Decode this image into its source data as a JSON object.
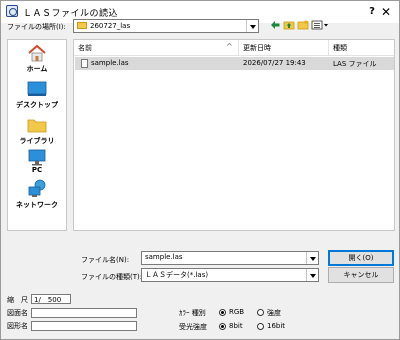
{
  "window": {
    "title": "ＬＡＳファイルの読込",
    "help_label": "?",
    "close_label": "✕"
  },
  "location": {
    "label": "ファイルの場所(I):",
    "value": "260727_las"
  },
  "places": [
    {
      "label": "ホーム",
      "icon": "home-icon"
    },
    {
      "label": "デスクトップ",
      "icon": "desktop-icon"
    },
    {
      "label": "ライブラリ",
      "icon": "library-icon"
    },
    {
      "label": "PC",
      "icon": "pc-icon"
    },
    {
      "label": "ネットワーク",
      "icon": "network-icon"
    }
  ],
  "file_list": {
    "columns": [
      "名前",
      "更新日時",
      "種類"
    ],
    "rows": [
      {
        "name": "sample.las",
        "modified": "2026/07/27 19:43",
        "type": "LAS ファイル"
      }
    ]
  },
  "filename": {
    "label": "ファイル名(N):",
    "value": "sample.las"
  },
  "filetype": {
    "label": "ファイルの種類(T):",
    "value": "ＬＡＳデータ(*.las)"
  },
  "buttons": {
    "open": "開く(O)",
    "cancel": "キャンセル"
  },
  "scale": {
    "label": "縮　尺",
    "value": "1/　500"
  },
  "drawing_name": {
    "label": "図面名",
    "value": ""
  },
  "shape_name": {
    "label": "図形名",
    "value": ""
  },
  "color_type": {
    "label": "ｶﾗｰ 種別",
    "options": [
      "RGB",
      "強度"
    ],
    "selected": "RGB"
  },
  "intensity": {
    "label": "受光強度",
    "options": [
      "8bit",
      "16bit"
    ],
    "selected": "8bit"
  },
  "colors": {
    "folder": "#f1c84a",
    "selection": "#d9d9d9",
    "accent": "#0078d7"
  }
}
